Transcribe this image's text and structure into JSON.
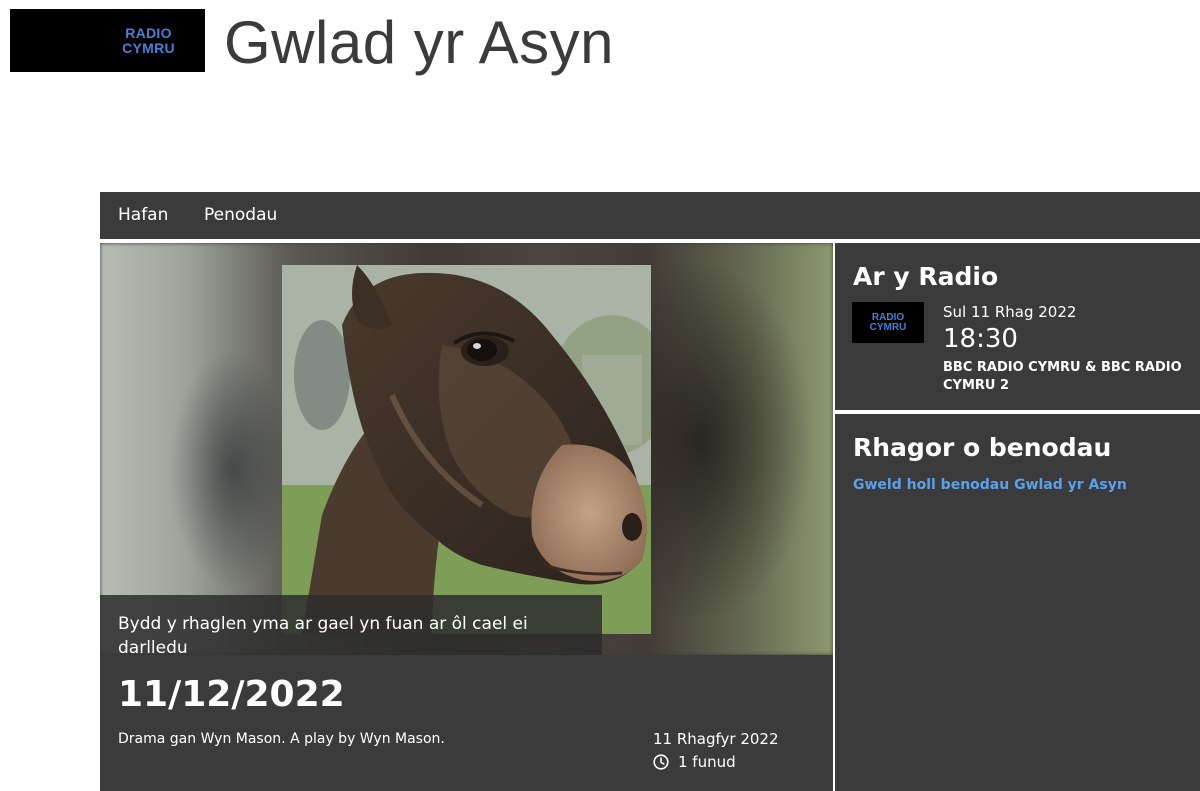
{
  "header": {
    "logo_line1": "RADIO",
    "logo_line2": "CYMRU",
    "title": "Gwlad yr Asyn"
  },
  "nav": {
    "items": [
      {
        "label": "Hafan"
      },
      {
        "label": "Penodau"
      }
    ]
  },
  "episode": {
    "image_caption": "Bydd y rhaglen yma ar gael yn fuan ar ôl cael ei darlledu",
    "title": "11/12/2022",
    "description": "Drama gan Wyn Mason. A play by Wyn Mason.",
    "date": "11 Rhagfyr 2022",
    "duration": "1 funud"
  },
  "on_air": {
    "heading": "Ar y Radio",
    "logo_line1": "RADIO",
    "logo_line2": "CYMRU",
    "day": "Sul 11 Rhag 2022",
    "time": "18:30",
    "station": "BBC RADIO CYMRU & BBC RADIO CYMRU 2"
  },
  "more_episodes": {
    "heading": "Rhagor o benodau",
    "link": "Gweld holl benodau Gwlad yr Asyn"
  },
  "colors": {
    "panel": "#3b3b3b",
    "logo_text": "#4a7fd4",
    "link": "#5aa0ea"
  },
  "icons": {
    "duration": "clock-icon"
  }
}
